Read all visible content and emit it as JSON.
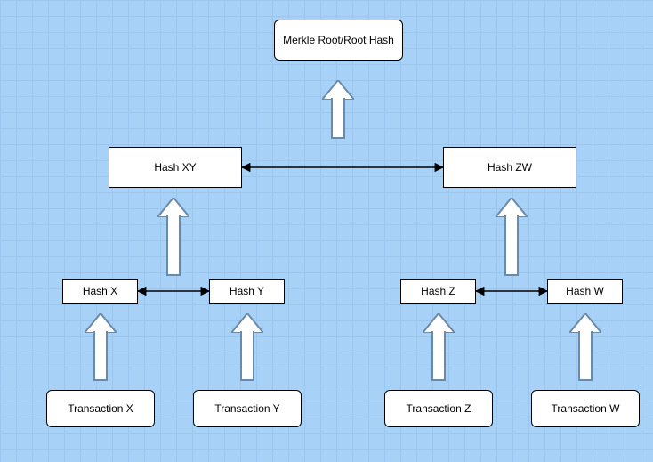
{
  "diagram": {
    "type": "merkle-tree",
    "nodes": {
      "root": {
        "label": "Merkle Root/Root Hash"
      },
      "hashXY": {
        "label": "Hash XY"
      },
      "hashZW": {
        "label": "Hash ZW"
      },
      "hashX": {
        "label": "Hash X"
      },
      "hashY": {
        "label": "Hash Y"
      },
      "hashZ": {
        "label": "Hash Z"
      },
      "hashW": {
        "label": "Hash W"
      },
      "txX": {
        "label": "Transaction X"
      },
      "txY": {
        "label": "Transaction Y"
      },
      "txZ": {
        "label": "Transaction Z"
      },
      "txW": {
        "label": "Transaction W"
      }
    },
    "edges": [
      {
        "from": "txX",
        "to": "hashX",
        "style": "block-arrow-up"
      },
      {
        "from": "txY",
        "to": "hashY",
        "style": "block-arrow-up"
      },
      {
        "from": "txZ",
        "to": "hashZ",
        "style": "block-arrow-up"
      },
      {
        "from": "txW",
        "to": "hashW",
        "style": "block-arrow-up"
      },
      {
        "from": "hashX",
        "to": "hashY",
        "style": "double-headed-line"
      },
      {
        "from": "hashZ",
        "to": "hashW",
        "style": "double-headed-line"
      },
      {
        "from": "hashX+hashY",
        "to": "hashXY",
        "style": "block-arrow-up"
      },
      {
        "from": "hashZ+hashW",
        "to": "hashZW",
        "style": "block-arrow-up"
      },
      {
        "from": "hashXY",
        "to": "hashZW",
        "style": "double-headed-line"
      },
      {
        "from": "hashXY+hashZW",
        "to": "root",
        "style": "block-arrow-up"
      }
    ]
  }
}
